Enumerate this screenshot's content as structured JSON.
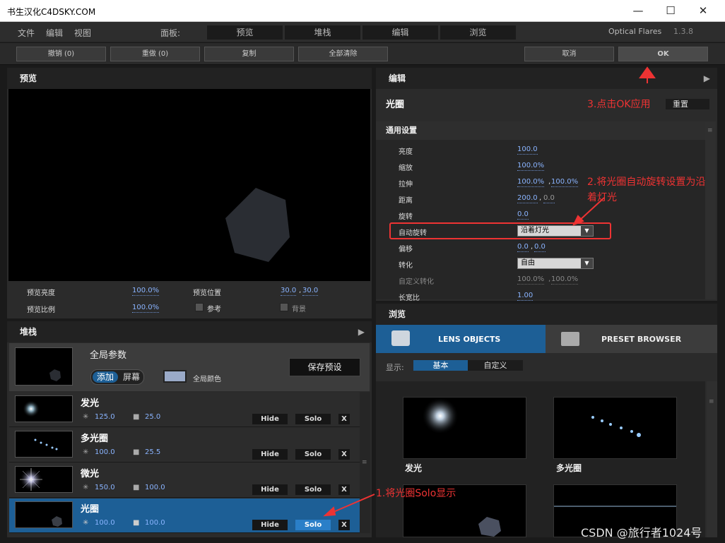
{
  "window": {
    "title": "书生汉化C4DSKY.COM",
    "minimize": "—",
    "maximize": "☐",
    "close": "✕"
  },
  "menu": {
    "file": "文件",
    "edit": "编辑",
    "view": "视图",
    "panel_label": "面板:",
    "tabs": [
      "预览",
      "堆栈",
      "编辑",
      "浏览"
    ],
    "product": "Optical Flares",
    "version": "1.3.8"
  },
  "toolbar": {
    "undo": "撤销 (0)",
    "redo": "重做 (0)",
    "copy": "复制",
    "clear_all": "全部清除",
    "cancel": "取消",
    "ok": "OK"
  },
  "preview": {
    "title": "预览",
    "brightness_label": "预览亮度",
    "brightness_value": "100.0%",
    "scale_label": "预览比例",
    "scale_value": "100.0%",
    "position_label": "预览位置",
    "position_x": "30.0",
    "position_y": "30.0",
    "reference_label": "参考",
    "background_label": "背景"
  },
  "stack": {
    "title": "堆栈",
    "global_params": "全局参数",
    "blend_add": "添加",
    "blend_screen": "屏幕",
    "global_color": "全局颜色",
    "save_preset": "保存预设",
    "layers": [
      {
        "name": "发光",
        "value1": "125.0",
        "value2": "25.0",
        "hide": "Hide",
        "solo": "Solo",
        "delete": "X",
        "selected": false
      },
      {
        "name": "多光圈",
        "value1": "100.0",
        "value2": "25.5",
        "hide": "Hide",
        "solo": "Solo",
        "delete": "X",
        "selected": false
      },
      {
        "name": "微光",
        "value1": "150.0",
        "value2": "100.0",
        "hide": "Hide",
        "solo": "Solo",
        "delete": "X",
        "selected": false
      },
      {
        "name": "光圈",
        "value1": "100.0",
        "value2": "100.0",
        "hide": "Hide",
        "solo": "Solo",
        "delete": "X",
        "selected": true
      }
    ]
  },
  "editor": {
    "title": "编辑",
    "object_name": "光圈",
    "reset": "重置",
    "section": "通用设置",
    "props": {
      "brightness_label": "亮度",
      "brightness": "100.0",
      "scale_label": "缩放",
      "scale": "100.0%",
      "stretch_label": "拉伸",
      "stretch_x": "100.0%",
      "stretch_y": "100.0%",
      "distance_label": "距离",
      "distance_a": "200.0",
      "distance_b": "0.0",
      "rotation_label": "旋转",
      "rotation": "0.0",
      "auto_rotate_label": "自动旋转",
      "auto_rotate": "沿着灯光",
      "offset_label": "偏移",
      "offset_x": "0.0",
      "offset_y": "0.0",
      "transform_label": "转化",
      "transform": "自由",
      "custom_transform_label": "自定义转化",
      "custom_x": "100.0%",
      "custom_y": "100.0%",
      "aspect_label": "长宽比",
      "aspect": "1.00"
    }
  },
  "browser": {
    "title": "浏览",
    "lens_objects": "LENS OBJECTS",
    "preset_browser": "PRESET BROWSER",
    "show_label": "显示:",
    "basic": "基本",
    "custom": "自定义",
    "items": [
      "发光",
      "多光圈"
    ]
  },
  "annotations": {
    "step1": "1.将光圈Solo显示",
    "step2_line1": "2.将光圈自动旋转设置为沿",
    "step2_line2": "着灯光",
    "step3": "3.点击OK应用"
  },
  "watermark": "CSDN @旅行者1024号",
  "colors": {
    "accent": "#1d5f96",
    "annotation": "#e33333",
    "value": "#8ab4ff"
  }
}
